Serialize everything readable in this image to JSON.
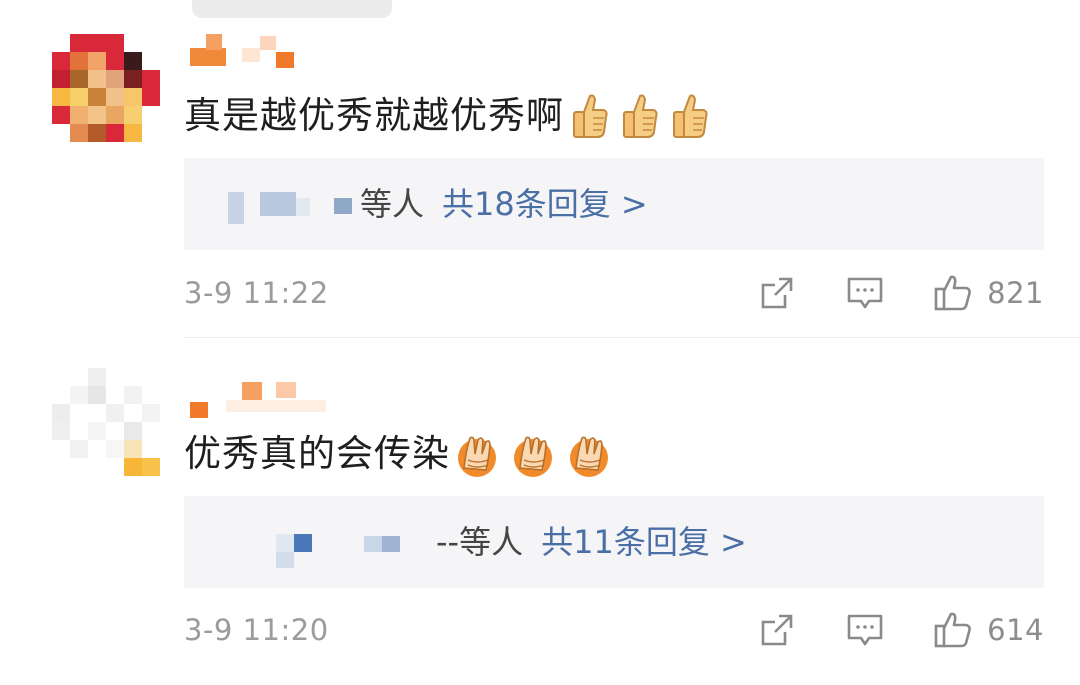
{
  "comments": [
    {
      "text": "真是越优秀就越优秀啊",
      "emoji": "thumbs-up",
      "reply_suffix": "等人",
      "reply_count_label": "共18条回复 >",
      "timestamp": "3-9 11:22",
      "likes": "821"
    },
    {
      "text": "优秀真的会传染",
      "emoji": "hands-cover-face",
      "reply_suffix": "--等人",
      "reply_count_label": "共11条回复 >",
      "timestamp": "3-9 11:20",
      "likes": "614"
    }
  ],
  "colors": {
    "reply_link": "#4a6fa5",
    "meta_text": "#9b9b9b",
    "reply_bg": "#f5f5f7",
    "icon_stroke": "#8a8a8a"
  }
}
